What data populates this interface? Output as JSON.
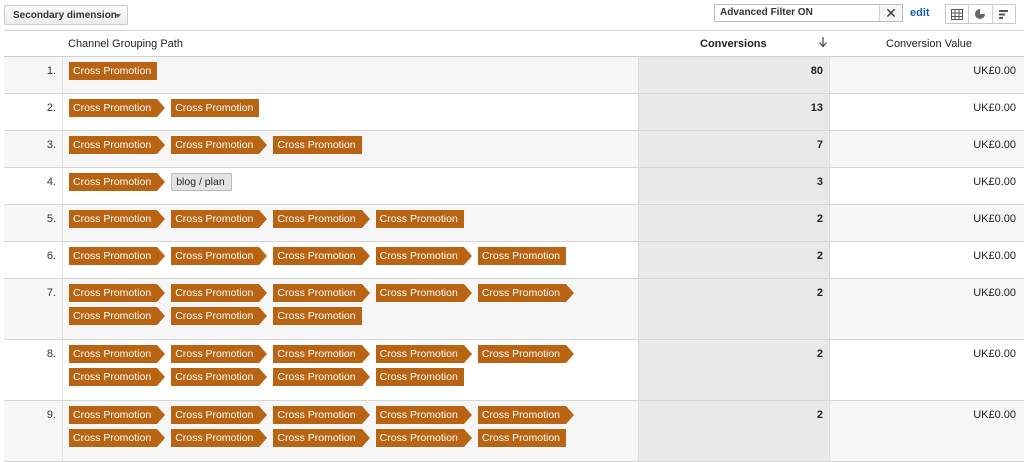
{
  "toolbar": {
    "secondary_dimension_label": "Secondary dimension",
    "filter_value": "Advanced Filter ON",
    "clear_label": "✕",
    "edit_label": "edit",
    "view_icons": [
      "table-view-icon",
      "pie-view-icon",
      "performance-view-icon"
    ]
  },
  "table": {
    "columns": {
      "path": "Channel Grouping Path",
      "conversions": "Conversions",
      "conversion_value": "Conversion Value"
    },
    "sort_icon": "arrow-down-icon",
    "rows": [
      {
        "rank": "1.",
        "path": [
          "Cross Promotion"
        ],
        "conversions": "80",
        "value": "UK£0.00"
      },
      {
        "rank": "2.",
        "path": [
          "Cross Promotion",
          "Cross Promotion"
        ],
        "conversions": "13",
        "value": "UK£0.00"
      },
      {
        "rank": "3.",
        "path": [
          "Cross Promotion",
          "Cross Promotion",
          "Cross Promotion"
        ],
        "conversions": "7",
        "value": "UK£0.00"
      },
      {
        "rank": "4.",
        "path": [
          "Cross Promotion",
          "blog / plan"
        ],
        "conversions": "3",
        "value": "UK£0.00"
      },
      {
        "rank": "5.",
        "path": [
          "Cross Promotion",
          "Cross Promotion",
          "Cross Promotion",
          "Cross Promotion"
        ],
        "conversions": "2",
        "value": "UK£0.00"
      },
      {
        "rank": "6.",
        "path": [
          "Cross Promotion",
          "Cross Promotion",
          "Cross Promotion",
          "Cross Promotion",
          "Cross Promotion"
        ],
        "conversions": "2",
        "value": "UK£0.00"
      },
      {
        "rank": "7.",
        "path": [
          "Cross Promotion",
          "Cross Promotion",
          "Cross Promotion",
          "Cross Promotion",
          "Cross Promotion",
          "Cross Promotion",
          "Cross Promotion",
          "Cross Promotion"
        ],
        "conversions": "2",
        "value": "UK£0.00"
      },
      {
        "rank": "8.",
        "path": [
          "Cross Promotion",
          "Cross Promotion",
          "Cross Promotion",
          "Cross Promotion",
          "Cross Promotion",
          "Cross Promotion",
          "Cross Promotion",
          "Cross Promotion",
          "Cross Promotion"
        ],
        "conversions": "2",
        "value": "UK£0.00"
      },
      {
        "rank": "9.",
        "path": [
          "Cross Promotion",
          "Cross Promotion",
          "Cross Promotion",
          "Cross Promotion",
          "Cross Promotion",
          "Cross Promotion",
          "Cross Promotion",
          "Cross Promotion",
          "Cross Promotion",
          "Cross Promotion"
        ],
        "conversions": "2",
        "value": "UK£0.00"
      }
    ]
  },
  "colors": {
    "chip_channel": "#b86412",
    "chip_other": "#e3e3e3",
    "link": "#1a5fa7"
  }
}
